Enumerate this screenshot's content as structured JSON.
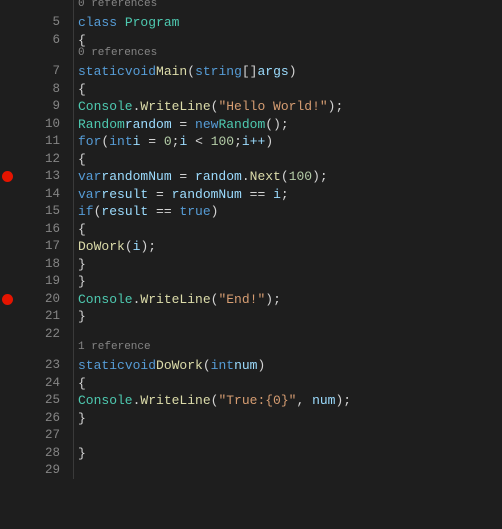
{
  "lines": [
    {
      "num": "5"
    },
    {
      "num": "6"
    },
    {
      "num": "7"
    },
    {
      "num": "8"
    },
    {
      "num": "9"
    },
    {
      "num": "10"
    },
    {
      "num": "11"
    },
    {
      "num": "12"
    },
    {
      "num": "13",
      "bp": true
    },
    {
      "num": "14"
    },
    {
      "num": "15"
    },
    {
      "num": "16"
    },
    {
      "num": "17"
    },
    {
      "num": "18"
    },
    {
      "num": "19"
    },
    {
      "num": "20",
      "bp": true
    },
    {
      "num": "21"
    },
    {
      "num": "22"
    },
    {
      "num": "23"
    },
    {
      "num": "24"
    },
    {
      "num": "25"
    },
    {
      "num": "26"
    },
    {
      "num": "27"
    },
    {
      "num": "28"
    },
    {
      "num": "29"
    }
  ],
  "codelens": {
    "class": "0 references",
    "main": "0 references",
    "dowork": "1 reference"
  },
  "tok": {
    "class": "class",
    "program": "Program",
    "brace_o": "{",
    "brace_c": "}",
    "static": "static",
    "void": "void",
    "main": "Main",
    "string": "string",
    "brackets": "[]",
    "args": "args",
    "paren_o": "(",
    "paren_c": ")",
    "semi": ";",
    "comma": ",",
    "console": "Console",
    "dot": ".",
    "writeline": "WriteLine",
    "str_hello": "\"Hello World!\"",
    "random_cls": "Random",
    "random_var": "random",
    "eq": " = ",
    "new": "new",
    "for": "for",
    "int": "int",
    "i": "i",
    "zero": "0",
    "lt": " < ",
    "hundred": "100",
    "ipp": "i++",
    "eq2": " = ",
    "var": "var",
    "randomnum": "randomNum",
    "next": "Next",
    "result": "result",
    "eqeq": " == ",
    "if": "if",
    "true": "true",
    "dowork_call": "DoWork",
    "str_end": "\"End!\"",
    "dowork": "DoWork",
    "num_param": "num",
    "str_true": "\"True:{0}\"",
    "comma_sp": ", "
  }
}
